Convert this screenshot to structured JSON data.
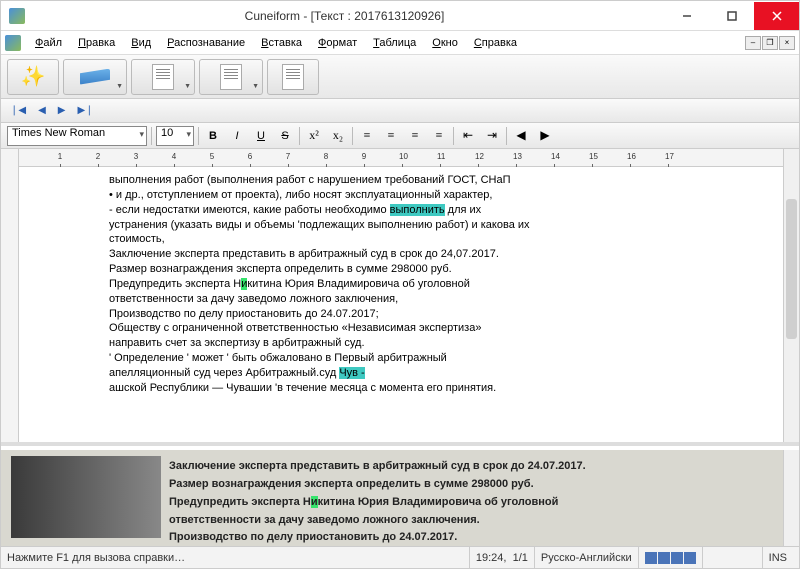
{
  "title": "Cuneiform - [Текст : 2017613120926]",
  "menu": [
    "Файл",
    "Правка",
    "Вид",
    "Распознавание",
    "Вставка",
    "Формат",
    "Таблица",
    "Окно",
    "Справка"
  ],
  "font": "Times New Roman",
  "size": "10",
  "ruler_ticks": [
    1,
    2,
    3,
    4,
    5,
    6,
    7,
    8,
    9,
    10,
    11,
    12,
    13,
    14,
    15,
    16,
    17
  ],
  "doc": {
    "l1": "выполнения работ (выполнения работ с нарушением требований ГОСТ, СНаП",
    "l2": "• и др., отступлением от проекта), либо носят эксплуатационный характер,",
    "l3a": "- если недостатки имеются, какие работы необходимо ",
    "l3h": "выполнить",
    "l3b": " для их",
    "l4": "устранения (указать виды и объемы 'подлежащих выполнению работ) и какова их",
    "l5": "стоимость,",
    "l6": "Заключение эксперта представить в арбитражный суд в срок до 24,07.2017.",
    "l7": "Размер вознаграждения эксперта определить в сумме 298000 руб.",
    "l8a": "Предупредить эксперта Н",
    "l8h": "и",
    "l8b": "китина Юрия Владимировича об уголовной",
    "l9": "ответственности за дачу заведомо ложного заключения,",
    "l10": "Производство по делу приостановить до 24.07.2017;",
    "l11": "Обществу с ограниченной ответственностью «Независимая экспертиза»",
    "l12": "направить счет за экспертизу в арбитражный суд.",
    "l13": "' Определение ' может ' быть обжаловано в Первый арбитражный",
    "l14a": "апелляционный суд через Арбитражный.суд ",
    "l14h": "Чув -",
    "l15": "ашской Республики — Чувашии 'в течение месяца с момента его принятия."
  },
  "img": {
    "r1": "Заключение эксперта представить в арбитражный суд в срок до 24.07.2017.",
    "r2": "Размер вознаграждения эксперта определить в сумме 298000 руб.",
    "r3a": "Предупредить эксперта Н",
    "r3h": "и",
    "r3b": "китина Юрия Владимировича об уголовной",
    "r4": "ответственности за дачу заведомо ложного заключения.",
    "r5": "Производство по делу приостановить до 24.07.2017."
  },
  "status": {
    "hint": "Нажмите F1 для вызова справки…",
    "pos": "19:24,",
    "page": "1/1",
    "lang": "Русско-Английски",
    "ins": "INS"
  }
}
